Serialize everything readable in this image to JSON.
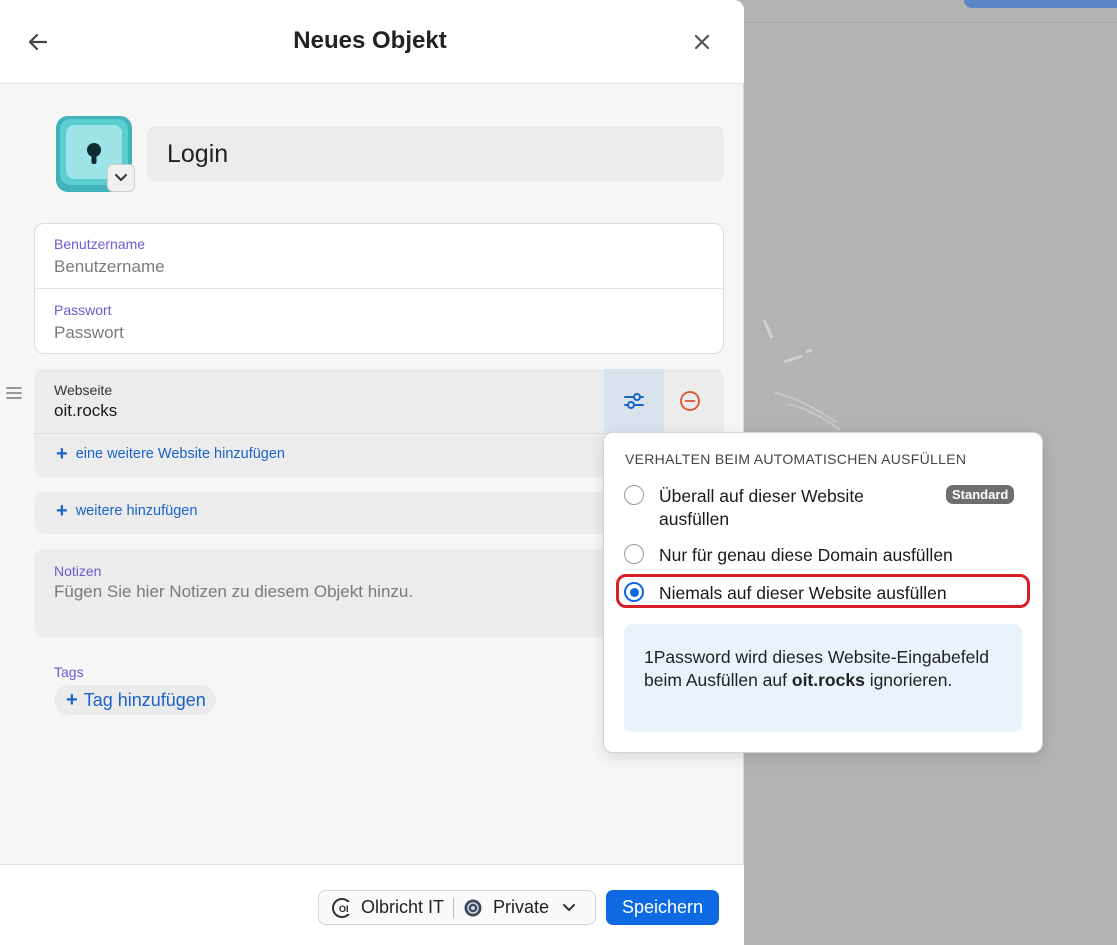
{
  "header": {
    "title": "Neues Objekt"
  },
  "item": {
    "title_value": "Login",
    "icon": "keyhole-icon"
  },
  "credentials": {
    "username_label": "Benutzername",
    "username_placeholder": "Benutzername",
    "password_label": "Passwort",
    "password_placeholder": "Passwort"
  },
  "website": {
    "label": "Webseite",
    "value": "oit.rocks",
    "add_link": "eine weitere Website hinzufügen"
  },
  "more": {
    "add_link": "weitere hinzufügen"
  },
  "notes": {
    "label": "Notizen",
    "placeholder": "Fügen Sie hier Notizen zu diesem Objekt hinzu."
  },
  "tags": {
    "label": "Tags",
    "add_button": "Tag hinzufügen"
  },
  "footer": {
    "account": "Olbricht IT",
    "vault": "Private",
    "save_label": "Speichern"
  },
  "popover": {
    "title": "VERHALTEN BEIM AUTOMATISCHEN AUSFÜLLEN",
    "options": [
      {
        "label": "Überall auf dieser Website ausfüllen",
        "badge": "Standard",
        "selected": false
      },
      {
        "label": "Nur für genau diese Domain ausfüllen",
        "selected": false
      },
      {
        "label": "Niemals auf dieser Website ausfüllen",
        "selected": true
      }
    ],
    "info_prefix": "1Password wird dieses Website-Eingabefeld beim Ausfüllen auf ",
    "info_domain": "oit.rocks",
    "info_suffix": " ignorieren."
  },
  "colors": {
    "accent": "#0d6ae3",
    "link": "#1a63c9",
    "label": "#6c5bcf",
    "highlight": "#d91f26",
    "icon_teal": "#5ccdd0"
  }
}
